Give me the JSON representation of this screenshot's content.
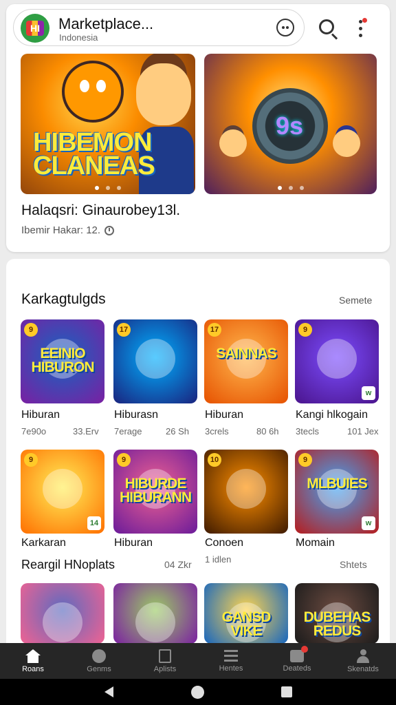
{
  "header": {
    "logo_text": "HI",
    "title": "Marketplace...",
    "subtitle": "Indonesia",
    "icons": [
      "logo-icon",
      "smiley-icon",
      "search-icon",
      "more-vert-icon"
    ]
  },
  "featured": {
    "banner_1_text": "HIBEMON CLANEAS",
    "banner_2_text": "9s",
    "title": "Halaqsri: Ginaurobey13l.",
    "meta": "Ibemir Hakar: 12."
  },
  "section": {
    "title": "Karkagtulgds",
    "more": "Semete"
  },
  "tiles": [
    {
      "word": "EEINIO HIBURON",
      "badge": "9",
      "name": "Hiburan",
      "meta_l": "7e90o",
      "meta_r": "33.Erv",
      "colors": [
        "#1565c0",
        "#7b1fa2"
      ]
    },
    {
      "word": "",
      "badge": "17",
      "name": "Hiburasn",
      "meta_l": "7erage",
      "meta_r": "26 Sh",
      "colors": [
        "#00b0ff",
        "#1a237e"
      ]
    },
    {
      "word": "SAINNAS",
      "badge": "17",
      "name": "Hiburan",
      "meta_l": "3crels",
      "meta_r": "80 6h",
      "colors": [
        "#ffb74d",
        "#e65100"
      ]
    },
    {
      "word": "",
      "badge": "9",
      "corner": "w",
      "name": "Kangi hlkogain",
      "meta_l": "3tecls",
      "meta_r": "101 Jex",
      "colors": [
        "#7c4dff",
        "#4a148c"
      ]
    },
    {
      "word": "",
      "badge": "9",
      "corner": "14",
      "name": "Karkaran",
      "meta_l": "",
      "meta_r": "",
      "colors": [
        "#ffee58",
        "#ff6f00"
      ]
    },
    {
      "word": "HIBURDE HIBURANN",
      "badge": "9",
      "name": "Hiburan",
      "meta_l": "",
      "meta_r": "",
      "colors": [
        "#f06292",
        "#6a1b9a"
      ]
    },
    {
      "word": "",
      "badge": "10",
      "name": "Conoen",
      "meta_l": "1 idlen",
      "meta_r": "",
      "colors": [
        "#ff8f00",
        "#3e1a00"
      ]
    },
    {
      "word": "MLBUIES",
      "badge": "9",
      "corner": "w",
      "name": "Momain",
      "meta_l": "",
      "meta_r": "",
      "colors": [
        "#42a5f5",
        "#b71c1c"
      ]
    },
    {
      "word": "",
      "badge": "",
      "name": "",
      "meta_l": "",
      "meta_r": "",
      "colors": [
        "#5c6bc0",
        "#f06292"
      ]
    },
    {
      "word": "",
      "badge": "",
      "name": "",
      "meta_l": "",
      "meta_r": "",
      "colors": [
        "#9ccc65",
        "#7b1fa2"
      ]
    },
    {
      "word": "GANSD VIKE",
      "badge": "",
      "name": "",
      "meta_l": "",
      "meta_r": "",
      "colors": [
        "#ffd54f",
        "#1565c0"
      ]
    },
    {
      "word": "DUBEHAS REDUS",
      "badge": "",
      "name": "",
      "meta_l": "",
      "meta_r": "",
      "colors": [
        "#6d4c41",
        "#1b1b1b"
      ]
    }
  ],
  "row_label": {
    "left": "Reargil HNoplats",
    "middle": "04 Zkr",
    "right": "Shtets"
  },
  "bottom_nav": [
    {
      "label": "Roans",
      "icon": "home-icon",
      "active": true
    },
    {
      "label": "Genms",
      "icon": "games-icon",
      "active": false
    },
    {
      "label": "Aplists",
      "icon": "apps-icon",
      "active": false
    },
    {
      "label": "Hentes",
      "icon": "list-icon",
      "active": false
    },
    {
      "label": "Deateds",
      "icon": "download-icon",
      "active": false
    },
    {
      "label": "Skenatds",
      "icon": "profile-icon",
      "active": false
    }
  ],
  "system_nav": [
    "back-icon",
    "home-circle-icon",
    "recents-icon"
  ]
}
